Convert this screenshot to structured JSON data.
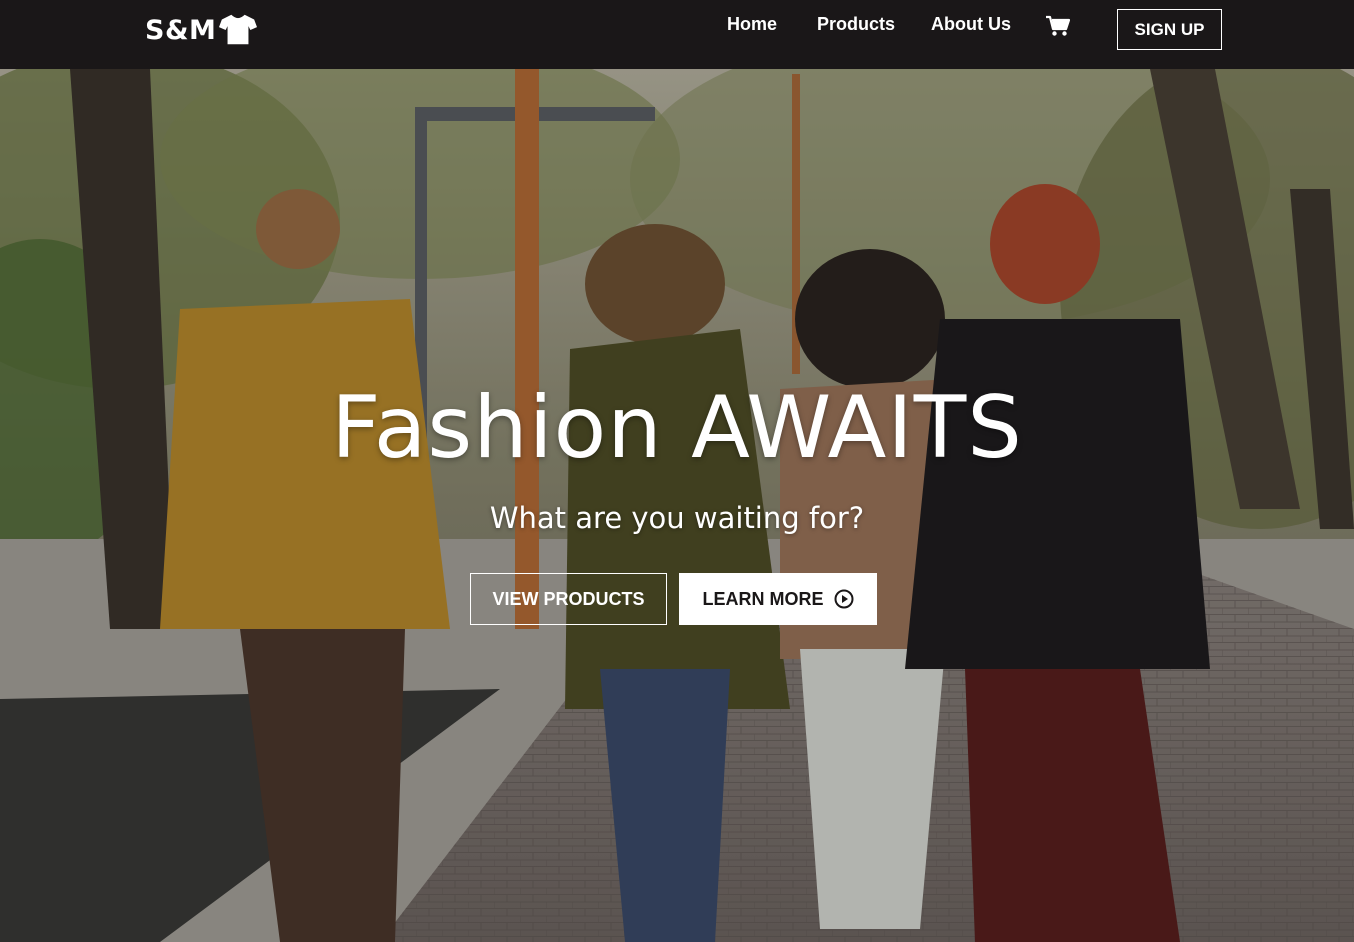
{
  "brand": {
    "name": "S&M",
    "icon": "tshirt-icon"
  },
  "nav": {
    "links": [
      "Home",
      "Products",
      "About Us"
    ],
    "cart_icon": "cart-icon",
    "signup_label": "SIGN UP"
  },
  "hero": {
    "title": "Fashion AWAITS",
    "subtitle": "What are you waiting for?",
    "primary_button": "VIEW PRODUCTS",
    "secondary_button": "LEARN MORE",
    "secondary_icon": "play-circle-icon"
  },
  "colors": {
    "navbar": "#1a1718",
    "text": "#ffffff",
    "button_fill": "#ffffff",
    "button_text": "#1a1718"
  }
}
